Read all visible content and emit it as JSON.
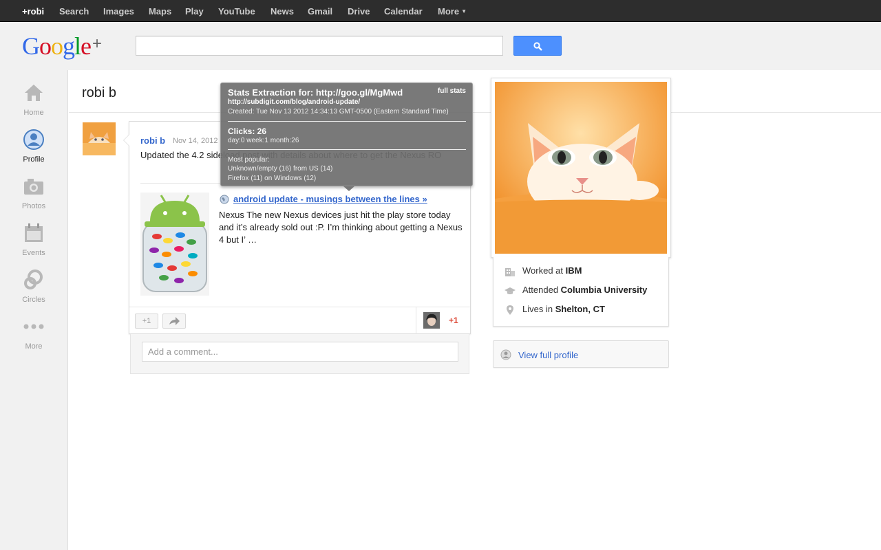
{
  "gbar": {
    "items": [
      "+robi",
      "Search",
      "Images",
      "Maps",
      "Play",
      "YouTube",
      "News",
      "Gmail",
      "Drive",
      "Calendar",
      "More"
    ]
  },
  "header": {
    "logo_text": "Google",
    "logo_plus": "+",
    "search_placeholder": ""
  },
  "leftnav": {
    "items": [
      {
        "label": "Home",
        "icon": "home-icon"
      },
      {
        "label": "Profile",
        "icon": "profile-icon"
      },
      {
        "label": "Photos",
        "icon": "camera-icon"
      },
      {
        "label": "Events",
        "icon": "calendar-icon"
      },
      {
        "label": "Circles",
        "icon": "circles-icon"
      },
      {
        "label": "More",
        "icon": "more-dots-icon"
      }
    ],
    "active": "Profile"
  },
  "profile": {
    "name": "robi b"
  },
  "post": {
    "author": "robi b",
    "date": "Nov 14, 2012",
    "text": "Updated the 4.2 sideload post with details about where to get the Nexus RO",
    "link_title": "android update - musings between the lines »",
    "link_desc": "Nexus The new Nexus devices just hit the play store today and it’s already sold out :P. I’m thinking about getting a Nexus 4 but I’ …",
    "plus_button": "+1",
    "plus_count": "+1",
    "comment_placeholder": "Add a comment..."
  },
  "tooltip": {
    "title": "Stats Extraction for: http://goo.gl/MgMwd",
    "full_stats": "full stats",
    "url": "http://subdigit.com/blog/android-update/",
    "created": "Created: Tue Nov 13 2012 14:34:13 GMT-0500 (Eastern Standard Time)",
    "clicks": "Clicks: 26",
    "breakdown": "day:0 week:1 month:26",
    "popular_label": "Most popular:",
    "popular_1": "Unknown/empty (16) from US (14)",
    "popular_2": "Firefox (11) on Windows (12)"
  },
  "about": {
    "work_prefix": "Worked at ",
    "work": "IBM",
    "edu_prefix": "Attended ",
    "edu": "Columbia University",
    "home_prefix": "Lives in ",
    "home": "Shelton, CT",
    "view_profile": "View full profile"
  },
  "colors": {
    "gbar_bg": "#2d2d2d",
    "link_blue": "#3366cc",
    "plus_red": "#dd4b39",
    "search_blue": "#4d90fe"
  }
}
